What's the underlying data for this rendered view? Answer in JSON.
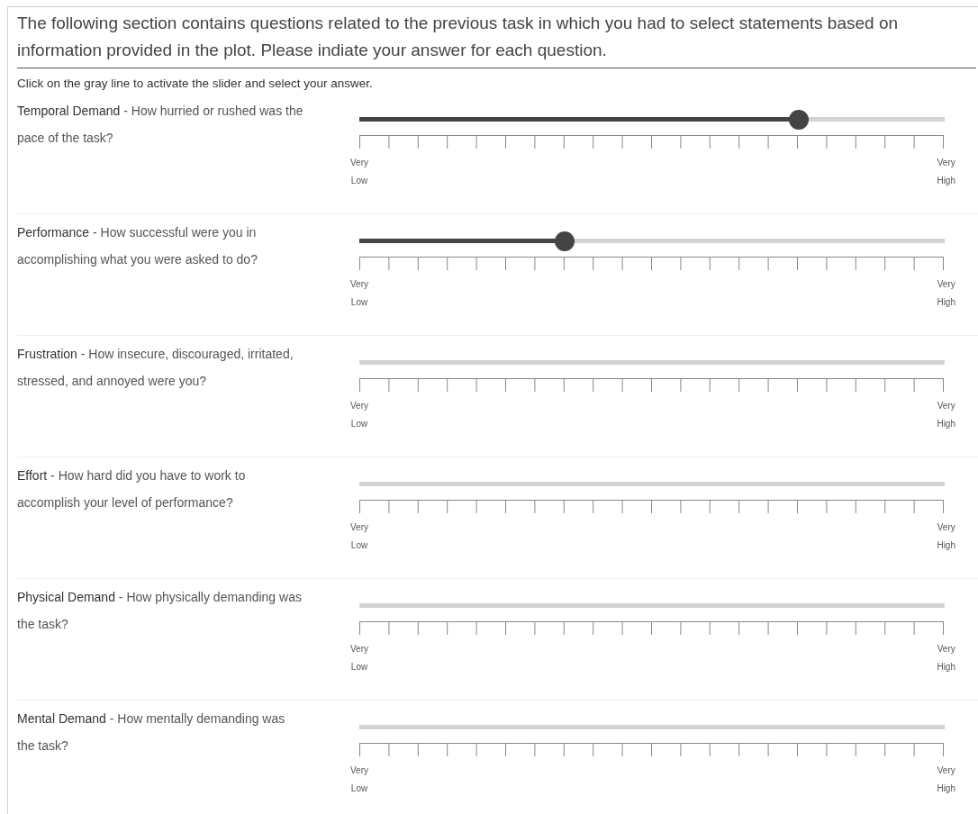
{
  "header": "The following section contains questions related to the previous task in which you had to select statements based on information provided in the plot. Please indiate your answer for each question.",
  "instruction": "Click on the gray line to activate the slider and select your answer.",
  "questions": [
    {
      "title": "Temporal Demand",
      "text": " - How hurried or rushed was the pace of the task?",
      "active": true,
      "level": 0.75,
      "low": [
        "Very",
        "Low"
      ],
      "high": [
        "Very",
        "High"
      ]
    },
    {
      "title": "Performance",
      "text": " - How successful were you in accomplishing what you were asked to do?",
      "active": true,
      "level": 0.35,
      "low": [
        "Very",
        "Low"
      ],
      "high": [
        "Very",
        "High"
      ]
    },
    {
      "title": "Frustration",
      "text": " - How insecure, discouraged, irritated, stressed, and annoyed were you?",
      "active": false,
      "low": [
        "Very",
        "Low"
      ],
      "high": [
        "Very",
        "High"
      ]
    },
    {
      "title": "Effort",
      "text": " - How hard did you have to work to accomplish your level of performance?",
      "active": false,
      "low": [
        "Very",
        "Low"
      ],
      "high": [
        "Very",
        "High"
      ]
    },
    {
      "title": "Physical Demand",
      "text": " - How physically demanding was the task?",
      "active": false,
      "low": [
        "Very",
        "Low"
      ],
      "high": [
        "Very",
        "High"
      ]
    },
    {
      "title": "Mental Demand",
      "text": " - How mentally demanding was the task?",
      "active": false,
      "low": [
        "Very",
        "Low"
      ],
      "high": [
        "Very",
        "High"
      ]
    }
  ]
}
